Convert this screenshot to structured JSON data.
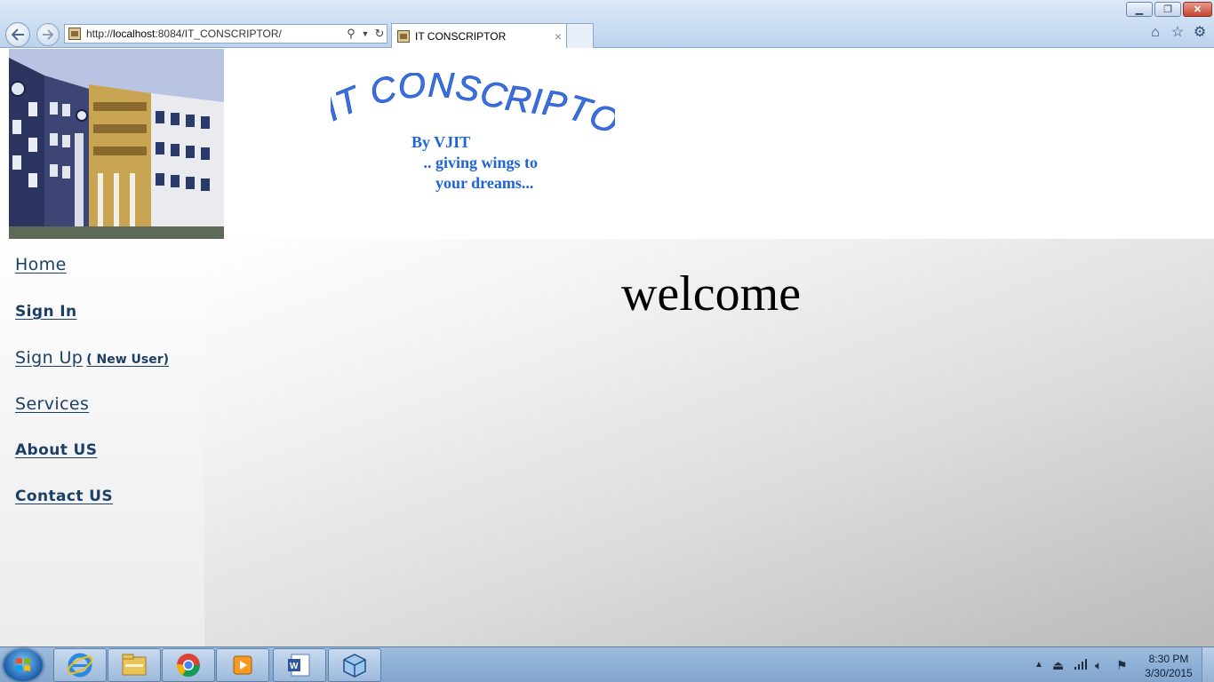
{
  "browser": {
    "url_prefix": "http://",
    "url_host": "localhost",
    "url_rest": ":8084/IT_CONSCRIPTOR/",
    "tab_title": "IT CONSCRIPTOR",
    "tab_close": "×"
  },
  "header": {
    "logo_text": "IT CONSCRIPTOR",
    "tagline": [
      "By VJIT",
      "   .. giving wings to",
      "      your dreams..."
    ],
    "logo_color": "#3a6fe0",
    "tagline_color": "#1f63d9"
  },
  "sidebar": {
    "items": [
      {
        "label": "Home"
      },
      {
        "label": "Sign In"
      },
      {
        "label": "Sign Up",
        "note": "( New User)"
      },
      {
        "label": "Services"
      },
      {
        "label": "About US"
      },
      {
        "label": "Contact US"
      }
    ],
    "link_color": "#1c3f66"
  },
  "main": {
    "welcome": "welcome"
  },
  "taskbar": {
    "apps": [
      "internet-explorer-icon",
      "file-explorer-icon",
      "chrome-icon",
      "media-player-icon",
      "word-icon",
      "virtualbox-icon"
    ],
    "time": "8:30 PM",
    "date": "3/30/2015"
  }
}
